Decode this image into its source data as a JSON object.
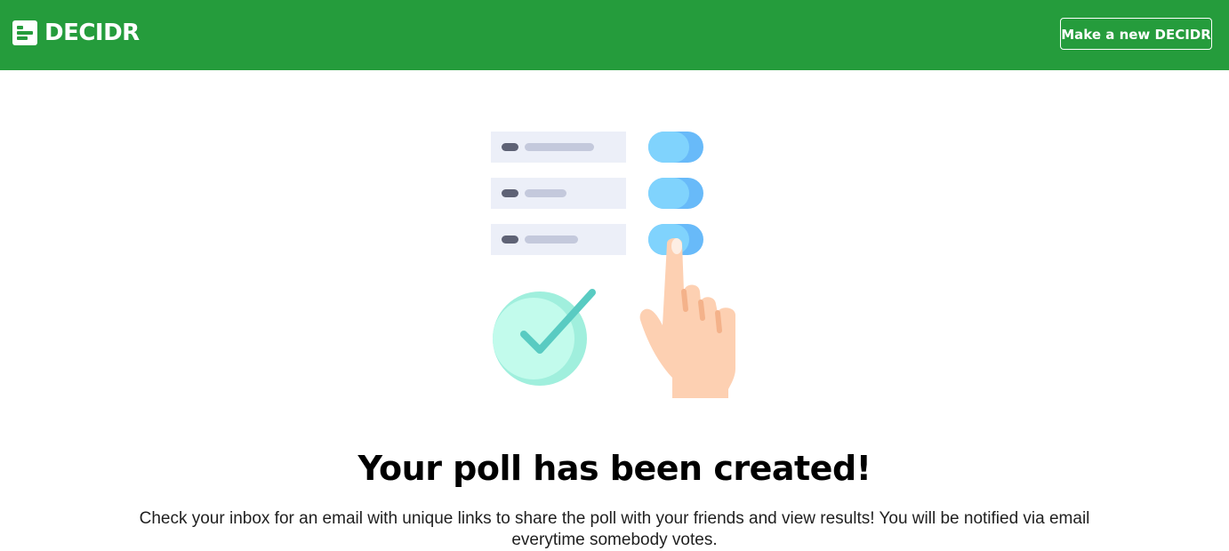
{
  "navbar": {
    "brand_name": "DECIDR",
    "brand_icon": "poll-form-icon",
    "new_button_label": "Make a new DECIDR",
    "background_color": "#259c3c"
  },
  "illustration": {
    "icons": [
      "poll-options-icon",
      "toggle-icon",
      "checkmark-circle-icon",
      "pointing-hand-icon"
    ]
  },
  "main": {
    "headline": "Your poll has been created!",
    "description": "Check your inbox for an email with unique links to share the poll with your friends and view results! You will be notified via email everytime somebody votes."
  }
}
